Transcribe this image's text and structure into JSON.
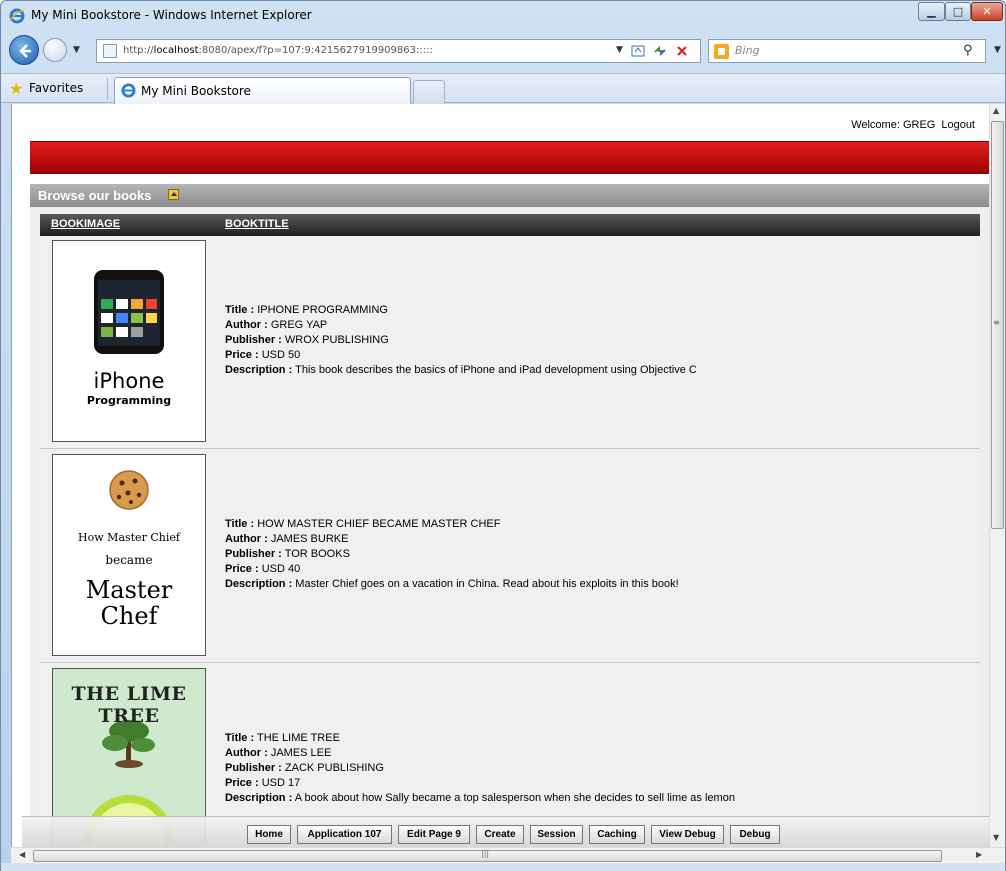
{
  "window": {
    "title": "My Mini Bookstore - Windows Internet Explorer"
  },
  "browser": {
    "url_prefix": "http://",
    "url_host": "localhost",
    "url_rest": ":8080/apex/f?p=107:9:4215627919909863:::::",
    "search_placeholder": "Bing",
    "favorites_label": "Favorites",
    "tab_title": "My Mini Bookstore"
  },
  "header": {
    "welcome": "Welcome: GREG",
    "logout": "Logout"
  },
  "region": {
    "title": "Browse our books"
  },
  "table": {
    "columns": [
      "BOOKIMAGE",
      "BOOKTITLE"
    ],
    "field_labels": {
      "title": "Title :",
      "author": "Author :",
      "publisher": "Publisher :",
      "price": "Price :",
      "description": "Description :"
    },
    "rows": [
      {
        "cover_lines": [
          "iPhone",
          "Programming"
        ],
        "title": "IPHONE PROGRAMMING",
        "author": "GREG YAP",
        "publisher": "WROX PUBLISHING",
        "price": "USD 50",
        "description": "This book describes the basics of iPhone and iPad development using Objective C"
      },
      {
        "cover_lines": [
          "How Master Chief",
          "became",
          "Master",
          "Chef"
        ],
        "title": "HOW MASTER CHIEF BECAME MASTER CHEF",
        "author": "JAMES BURKE",
        "publisher": "TOR BOOKS",
        "price": "USD 40",
        "description": "Master Chief goes on a vacation in China. Read about his exploits in this book!"
      },
      {
        "cover_lines": [
          "THE LIME TREE"
        ],
        "title": "THE LIME TREE",
        "author": "JAMES LEE",
        "publisher": "ZACK PUBLISHING",
        "price": "USD 17",
        "description": "A book about how Sally became a top salesperson when she decides to sell lime as lemon"
      }
    ]
  },
  "devbar": {
    "buttons": [
      "Home",
      "Application 107",
      "Edit Page 9",
      "Create",
      "Session",
      "Caching",
      "View Debug",
      "Debug"
    ]
  },
  "colors": {
    "header_red": "#c40000",
    "region_gray": "#9e9e9e",
    "table_header": "#2e2e2e"
  }
}
